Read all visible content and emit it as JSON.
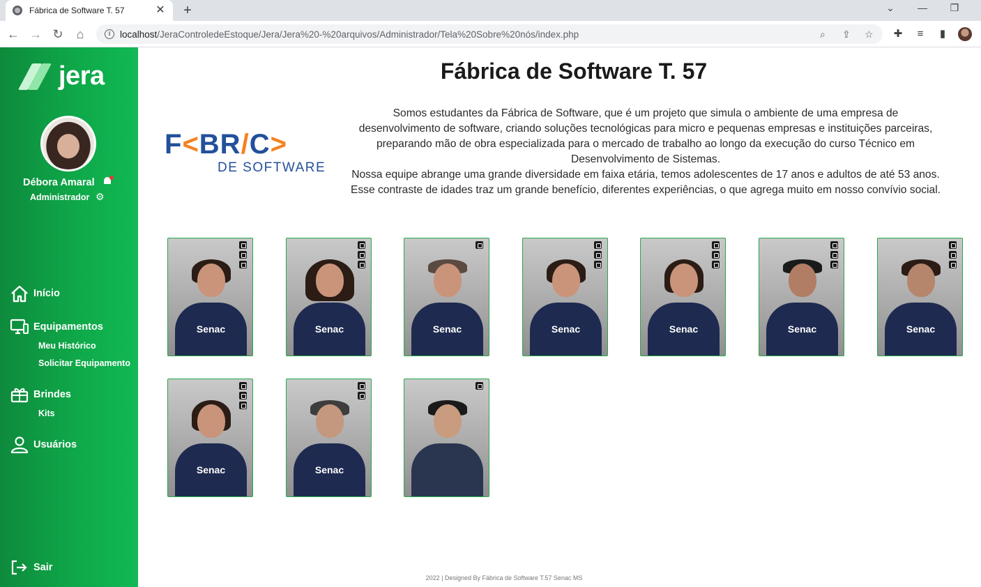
{
  "browser": {
    "tab_title": "Fábrica de Software T. 57",
    "tab_close": "✕",
    "new_tab": "+",
    "url_host": "localhost",
    "url_path": "/JeraControledeEstoque/Jera/Jera%20-%20arquivos/Administrador/Tela%20Sobre%20nós/index.php"
  },
  "sidebar": {
    "logo_text": "jera",
    "user_name": "Débora Amaral",
    "user_role": "Administrador",
    "menu": [
      {
        "label": "Início",
        "icon": "home-icon"
      },
      {
        "label": "Equipamentos",
        "icon": "monitor-icon"
      },
      {
        "label": "Brindes",
        "icon": "gift-icon"
      },
      {
        "label": "Usuários",
        "icon": "user-icon"
      }
    ],
    "submenu_equipamentos": [
      "Meu Histórico",
      "Solicitar Equipamento"
    ],
    "submenu_brindes": [
      "Kits"
    ],
    "logout_label": "Sair"
  },
  "main": {
    "title": "Fábrica de Software T. 57",
    "logo_letters": [
      "F",
      "<",
      "BR",
      "/",
      "C",
      ">"
    ],
    "logo_subtitle": "DE SOFTWARE",
    "description": [
      "Somos estudantes da Fábrica de Software, que é um projeto que simula o ambiente de uma empresa de",
      "desenvolvimento de software, criando soluções tecnológicas para micro e pequenas empresas e instituições parceiras,",
      "preparando mão de obra especializada para o mercado de trabalho ao longo da execução do curso Técnico em",
      "Desenvolvimento de Sistemas.",
      "Nossa equipe abrange uma grande diversidade em faixa etária, temos adolescentes de 17 anos e adultos de até 53 anos.",
      "Esse contraste de idades traz um grande benefício, diferentes experiências, o que agrega muito em nosso convívio social."
    ],
    "shirt_brand": "Senac",
    "footer": "2022 | Designed By Fábrica de Software T.57 Senac MS"
  },
  "colors": {
    "sidebar_green": "#11b954",
    "card_border": "#27a84a",
    "logo_blue": "#23509b",
    "logo_orange": "#f58220"
  }
}
